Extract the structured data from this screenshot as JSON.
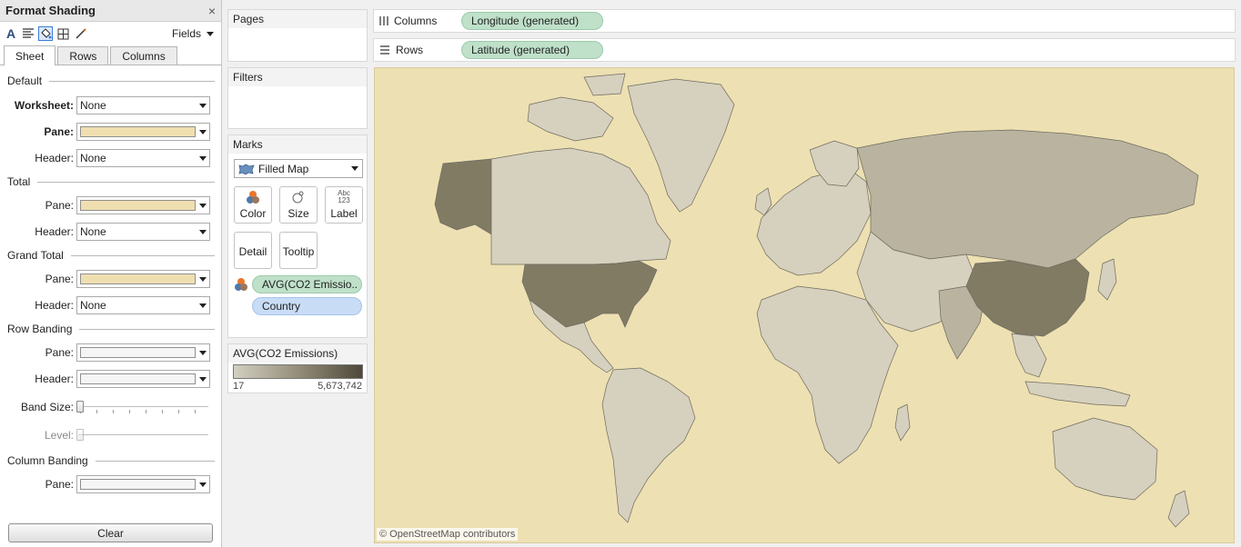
{
  "format_panel": {
    "title": "Format Shading",
    "close": "×",
    "fields_label": "Fields",
    "tabs": [
      {
        "label": "Sheet",
        "active": true
      },
      {
        "label": "Rows"
      },
      {
        "label": "Columns"
      }
    ],
    "sections": {
      "default": "Default",
      "total": "Total",
      "grand_total": "Grand Total",
      "row_banding": "Row Banding",
      "column_banding": "Column Banding"
    },
    "labels": {
      "worksheet": "Worksheet:",
      "pane": "Pane:",
      "header": "Header:",
      "band_size": "Band Size:",
      "level": "Level:"
    },
    "none_value": "None",
    "pane_color": "#efdfb0",
    "banding_color": "#f5f5f5",
    "band_size_value": 0,
    "level_value": 0,
    "clear_label": "Clear"
  },
  "shelves": {
    "pages": "Pages",
    "filters": "Filters",
    "marks": "Marks",
    "mark_type": "Filled Map",
    "mark_buttons": {
      "color": "Color",
      "size": "Size",
      "label": "Label",
      "detail": "Detail",
      "tooltip": "Tooltip"
    },
    "label_glyph": "Abc\n123",
    "pills": {
      "color_field": "AVG(CO2 Emissio..",
      "detail_field": "Country"
    },
    "legend": {
      "title": "AVG(CO2 Emissions)",
      "min": "17",
      "max": "5,673,742"
    }
  },
  "view": {
    "columns_label": "Columns",
    "rows_label": "Rows",
    "columns_pill": "Longitude (generated)",
    "rows_pill": "Latitude (generated)",
    "credit": "© OpenStreetMap contributors",
    "ocean_color": "#ede0b2",
    "land_color": "#d6d0be",
    "land_dark": "#827b64",
    "land_mid": "#b9b3a0"
  }
}
